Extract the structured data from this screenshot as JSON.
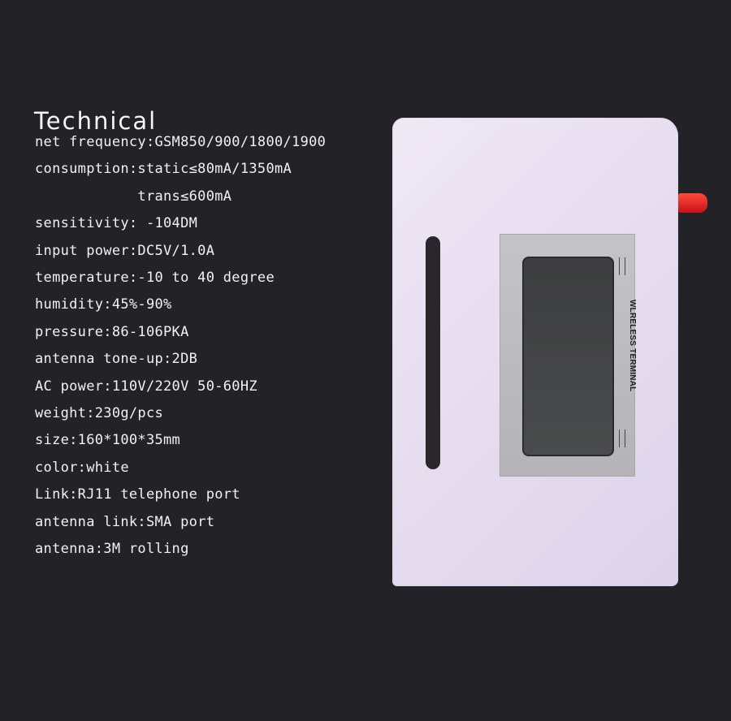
{
  "title": "Technical",
  "specs": [
    "net frequency:GSM850/900/1800/1900",
    "consumption:static≤80mA/1350mA",
    "            trans≤600mA",
    "sensitivity: -104DM",
    "input power:DC5V/1.0A",
    "temperature:-10 to 40 degree",
    "humidity:45%-90%",
    "pressure:86-106PKA",
    "antenna tone-up:2DB",
    "AC power:110V/220V 50-60HZ",
    "weight:230g/pcs",
    "size:160*100*35mm",
    "color:white",
    "Link:RJ11 telephone port",
    "antenna link:SMA port",
    "antenna:3M rolling"
  ],
  "device": {
    "label": "WLRELESS TERMINAL",
    "body_color": "#e8e0f0",
    "antenna_color": "#e0201f"
  }
}
